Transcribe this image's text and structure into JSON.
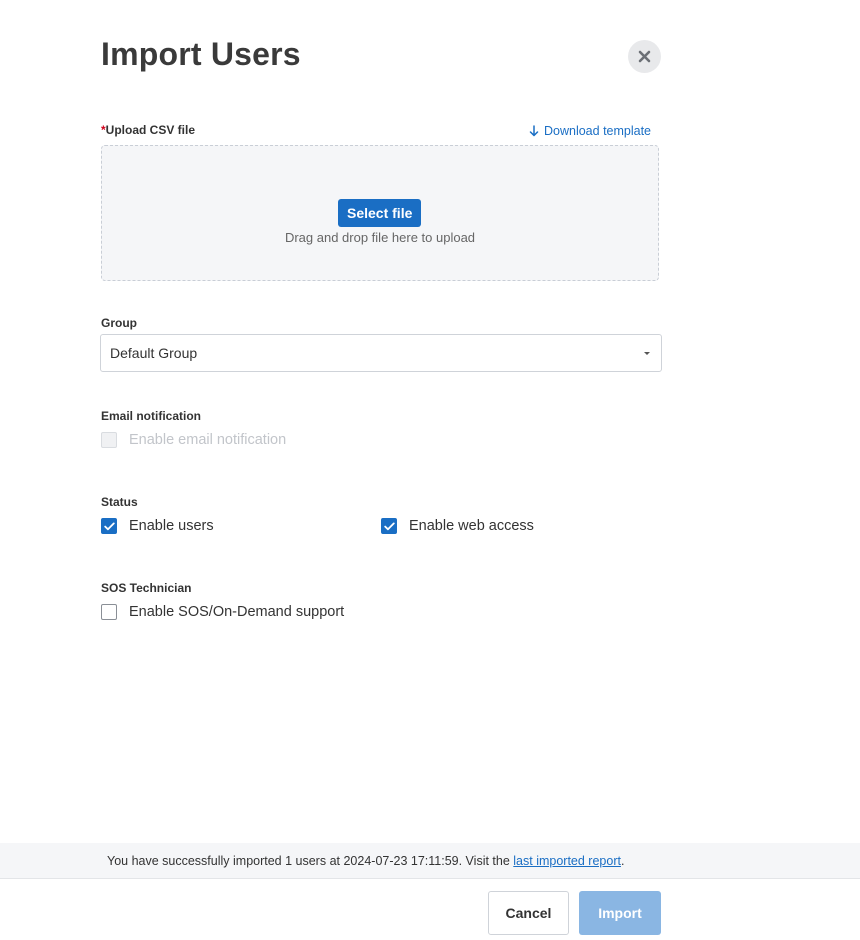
{
  "dialog": {
    "title": "Import Users"
  },
  "upload": {
    "required_mark": "*",
    "label": "Upload CSV file",
    "download_template": "Download template",
    "select_file_label": "Select file",
    "drop_hint": "Drag and drop file here to upload"
  },
  "group": {
    "label": "Group",
    "selected": "Default Group"
  },
  "email_notification": {
    "label": "Email notification",
    "option_label": "Enable email notification",
    "checked": false,
    "disabled": true
  },
  "status": {
    "label": "Status",
    "enable_users_label": "Enable users",
    "enable_users_checked": true,
    "enable_web_access_label": "Enable web access",
    "enable_web_access_checked": true
  },
  "sos": {
    "label": "SOS Technician",
    "option_label": "Enable SOS/On-Demand support",
    "checked": false
  },
  "status_bar": {
    "message": "You have successfully imported 1 users at 2024-07-23 17:11:59. Visit the ",
    "link_text": "last imported report",
    "suffix": "."
  },
  "footer": {
    "cancel_label": "Cancel",
    "import_label": "Import"
  },
  "colors": {
    "accent": "#1a6ec4",
    "import_disabled": "#8ab6e3",
    "required": "#d0021b"
  },
  "icons": {
    "close": "close-icon",
    "download": "arrow-down-icon",
    "dropdown": "caret-down-icon",
    "check": "checkmark-icon"
  }
}
